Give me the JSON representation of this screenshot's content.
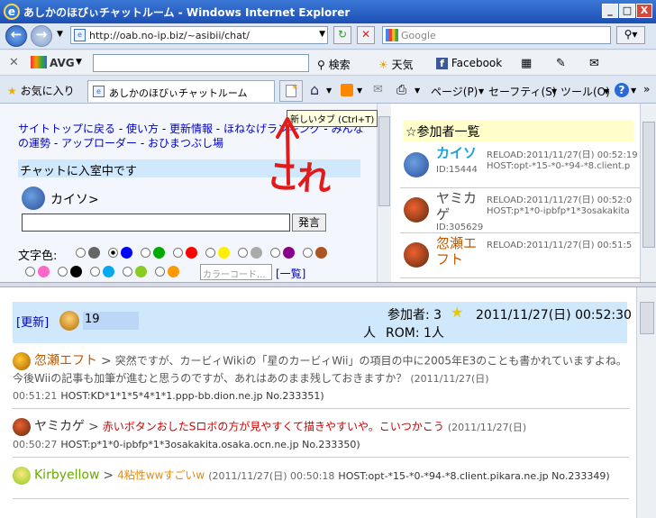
{
  "window": {
    "title": "あしかのほびぃチャットルーム - Windows Internet Explorer",
    "minimize": "_",
    "maximize": "□",
    "close": "X"
  },
  "address": {
    "url": "http://oab.no-ip.biz/~asibii/chat/",
    "search_placeholder": "Google"
  },
  "toolbar2": {
    "avg": "AVG",
    "search": "検索",
    "weather": "天気",
    "facebook": "Facebook"
  },
  "favbar": {
    "favorites": "お気に入り",
    "tab_title": "あしかのほびぃチャットルーム",
    "tooltip": "新しいタブ (Ctrl+T)",
    "page": "ページ(P)",
    "safety": "セーフティ(S)",
    "tools": "ツール(O)"
  },
  "annotation": {
    "text": "これ",
    "color": "#e21a1a"
  },
  "left_pane": {
    "links": [
      {
        "text": "サイトトップに戻る"
      },
      {
        "text": "使い方"
      },
      {
        "text": "更新情報"
      },
      {
        "text": "ほねなげランキング"
      },
      {
        "text": "みんなの運勢"
      },
      {
        "text": "アップローダー"
      },
      {
        "text": "おひまつぶし場"
      }
    ],
    "separator": " - ",
    "status": "チャットに入室中です",
    "username": "カイソ>",
    "send_button": "発言",
    "color_label": "文字色:",
    "color_code_placeholder": "カラーコード...",
    "list_link": "[一覧]",
    "colors_row1": [
      "#666666",
      "#0000ff",
      "#00aa00",
      "#ff0000",
      "#ffee00",
      "#aaaaaa",
      "#880088",
      "#aa5522"
    ],
    "colors_row2": [
      "#ff66cc",
      "#000000",
      "#00aaee",
      "#88cc22",
      "#ff9900"
    ]
  },
  "right_pane": {
    "title": "☆参加者一覧",
    "participants": [
      {
        "name": "カイソ",
        "id": "ID:15444",
        "reload": "RELOAD:2011/11/27(日) 00:52:19",
        "host": "HOST:opt-*15-*0-*94-*8.client.p",
        "color": "#1aa0d8"
      },
      {
        "name": "ヤミカゲ",
        "id": "ID:305629",
        "reload": "RELOAD:2011/11/27(日) 00:52:0",
        "host": "HOST:p*1*0-ipbfp*1*3osakakita",
        "color": "#444444"
      },
      {
        "name": "忽瀬エフト",
        "id": "",
        "reload": "RELOAD:2011/11/27(日) 00:51:5",
        "host": "",
        "color": "#c05a00"
      }
    ]
  },
  "chat": {
    "refresh": "[更新]",
    "count_value": "19",
    "participants_label": "参加者: 3",
    "participants_suffix": "人",
    "rom": "ROM: 1人",
    "datetime": "2011/11/27(日) 00:52:30",
    "messages": [
      {
        "name": "忽瀬エフト",
        "arrow": ">",
        "text": "突然ですが、カービィWikiの「星のカービィWii」の項目の中に2005年E3のことも書かれていますよね。今後Wiiの記事も加筆が進むと思うのですが、あれはあのまま残しておきますか？",
        "time": "(2011/11/27(日) 00:51:21",
        "host": "HOST:KD*1*1*5*4*1*1.ppp-bb.dion.ne.jp No.233351)",
        "name_color": "#c05a00",
        "text_color": "#555555"
      },
      {
        "name": "ヤミカゲ",
        "arrow": ">",
        "text": "赤いボタンおしたSロボの方が見やすくて描きやすいや。こいつかこう",
        "time": "(2011/11/27(日) 00:50:27",
        "host": "HOST:p*1*0-ipbfp*1*3osakakita.osaka.ocn.ne.jp No.233350)",
        "name_color": "#333333",
        "text_color": "#cc0000"
      },
      {
        "name": "Kirbyellow",
        "arrow": ">",
        "text": "4粘性wwすごいw",
        "time": "(2011/11/27(日) 00:50:18",
        "host": "HOST:opt-*15-*0-*94-*8.client.pikara.ne.jp No.233349)",
        "name_color": "#66aa00",
        "text_color": "#ee8800"
      }
    ]
  }
}
